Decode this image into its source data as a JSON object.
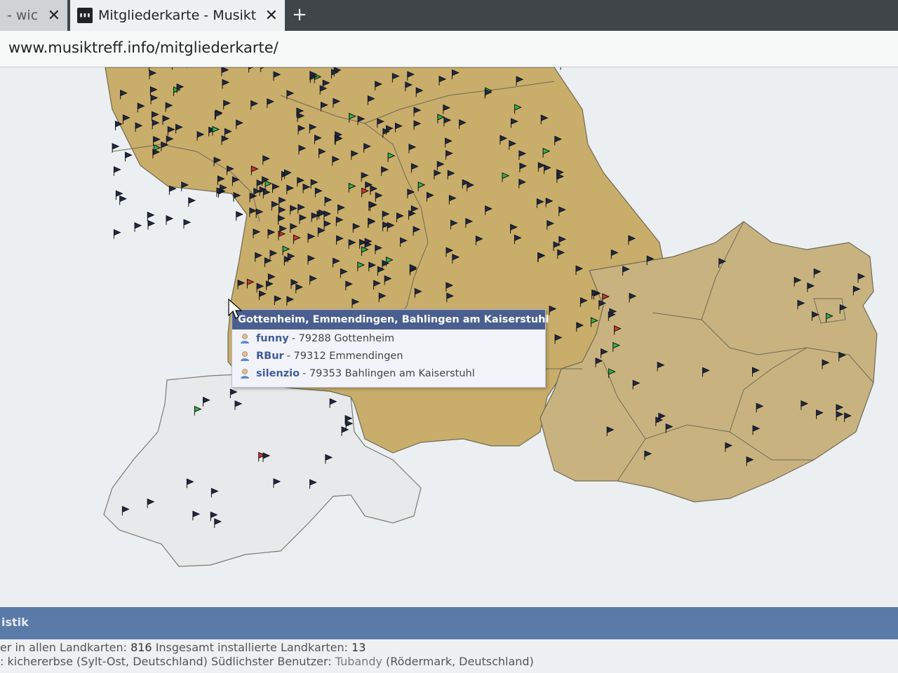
{
  "browser": {
    "tabs": [
      {
        "label": "- wic",
        "active": false
      },
      {
        "label": "Mitgliederkarte - Musiktreff",
        "active": true
      }
    ],
    "new_tab_label": "+",
    "close_glyph": "✕",
    "url": "www.musiktreff.info/mitgliederkarte/"
  },
  "map": {
    "popup": {
      "title": "Gottenheim, Emmendingen, Bahlingen am Kaiserstuhl",
      "members": [
        {
          "name": "funny",
          "location": " - 79288 Gottenheim"
        },
        {
          "name": "RBur",
          "location": " - 79312 Emmendingen"
        },
        {
          "name": "silenzio",
          "location": " - 79353 Bahlingen am Kaiserstuhl"
        }
      ]
    },
    "marker_colors": {
      "default": "#1f2a4a",
      "green": "#2fb34a",
      "red": "#d6342a"
    },
    "region_colors": {
      "germany": "#c9ad6a",
      "austria": "#c8b380",
      "switzerland": "#e8e9ea"
    }
  },
  "stats": {
    "title": "istik",
    "line1_a": "er in allen Landkarten: ",
    "line1_b": "816",
    "line1_c": "  Insgesamt installierte Landkarten: ",
    "line1_d": "13",
    "line2_a": ": kichererbse",
    "line2_b": " (Sylt-Ost, Deutschland)  Südlichster Benutzer: ",
    "line2_c": "Tubandy",
    "line2_d": " (Rödermark, Deutschland)"
  }
}
